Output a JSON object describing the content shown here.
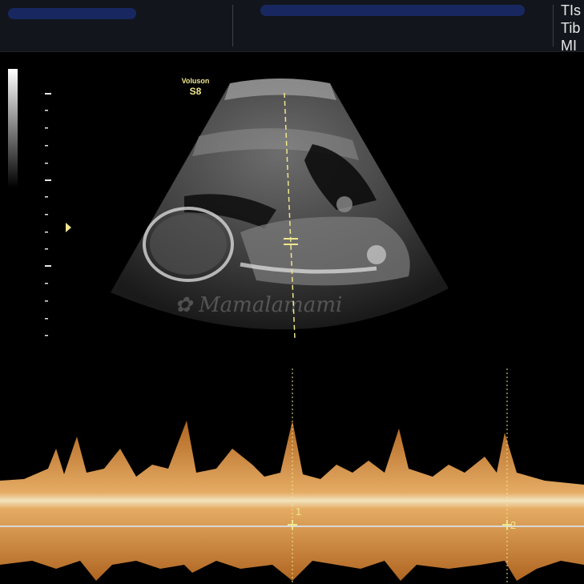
{
  "header": {
    "indices": [
      "TIs",
      "Tib",
      "MI"
    ]
  },
  "scanner": {
    "brand": "Voluson",
    "model": "S8"
  },
  "watermark": "Mamalamami",
  "doppler": {
    "cursor_labels": [
      "1",
      "2"
    ]
  },
  "icons": {
    "focus_marker": "triangle-right-icon",
    "logo": "flower-icon"
  },
  "colors": {
    "background": "#000000",
    "ultrasound_gray": "#8a8a8a",
    "measurement_yellow": "#f0e68c",
    "doppler_orange": "#e3a05a",
    "doppler_core": "#fff0c8"
  }
}
